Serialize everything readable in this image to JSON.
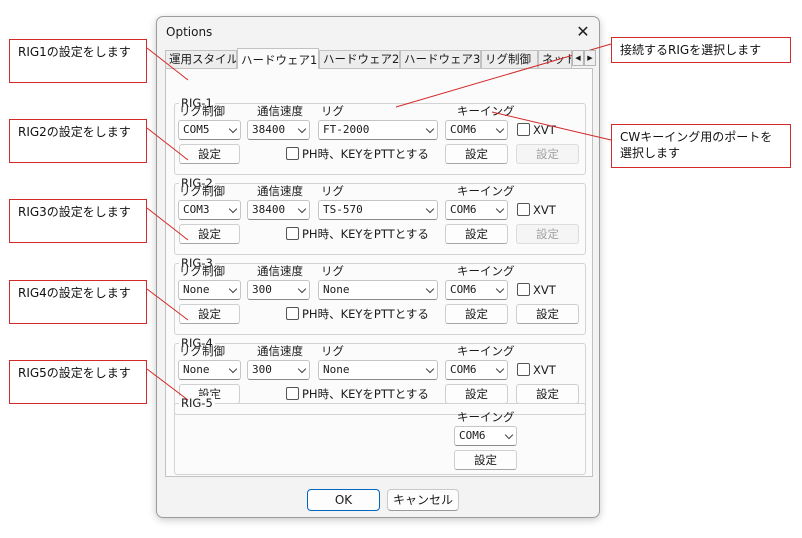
{
  "dialog": {
    "title": "Options",
    "tabs": [
      "運用スタイル",
      "ハードウェア1",
      "ハードウェア2",
      "ハードウェア3",
      "リグ制御",
      "ネット"
    ],
    "active_tab": "ハードウェア1",
    "ok_label": "OK",
    "cancel_label": "キャンセル"
  },
  "labels": {
    "rig_control": "リグ制御",
    "baud": "通信速度",
    "rig": "リグ",
    "keying": "キーイング",
    "xvt": "XVT",
    "ph_ptt": "PH時、KEYをPTTとする",
    "setting": "設定"
  },
  "rigs": [
    {
      "name": "RIG-1",
      "control": "COM5",
      "baud": "38400",
      "rig": "FT-2000",
      "keying": "COM6",
      "keying_setting_enabled": false
    },
    {
      "name": "RIG-2",
      "control": "COM3",
      "baud": "38400",
      "rig": "TS-570",
      "keying": "COM6",
      "keying_setting_enabled": false
    },
    {
      "name": "RIG-3",
      "control": "None",
      "baud": "300",
      "rig": "None",
      "keying": "COM6",
      "keying_setting_enabled": true
    },
    {
      "name": "RIG-4",
      "control": "None",
      "baud": "300",
      "rig": "None",
      "keying": "COM6",
      "keying_setting_enabled": true
    }
  ],
  "rig5": {
    "name": "RIG-5",
    "keying": "COM6"
  },
  "annotations": {
    "rig1": "RIG1の設定をします",
    "rig2": "RIG2の設定をします",
    "rig3": "RIG3の設定をします",
    "rig4": "RIG4の設定をします",
    "rig5": "RIG5の設定をします",
    "select_rig": "接続するRIGを選択します",
    "cw_port": "CWキーイング用のポートを選択します"
  },
  "colors": {
    "annotation_border": "#d22a2a",
    "primary_button": "#0067c0"
  }
}
